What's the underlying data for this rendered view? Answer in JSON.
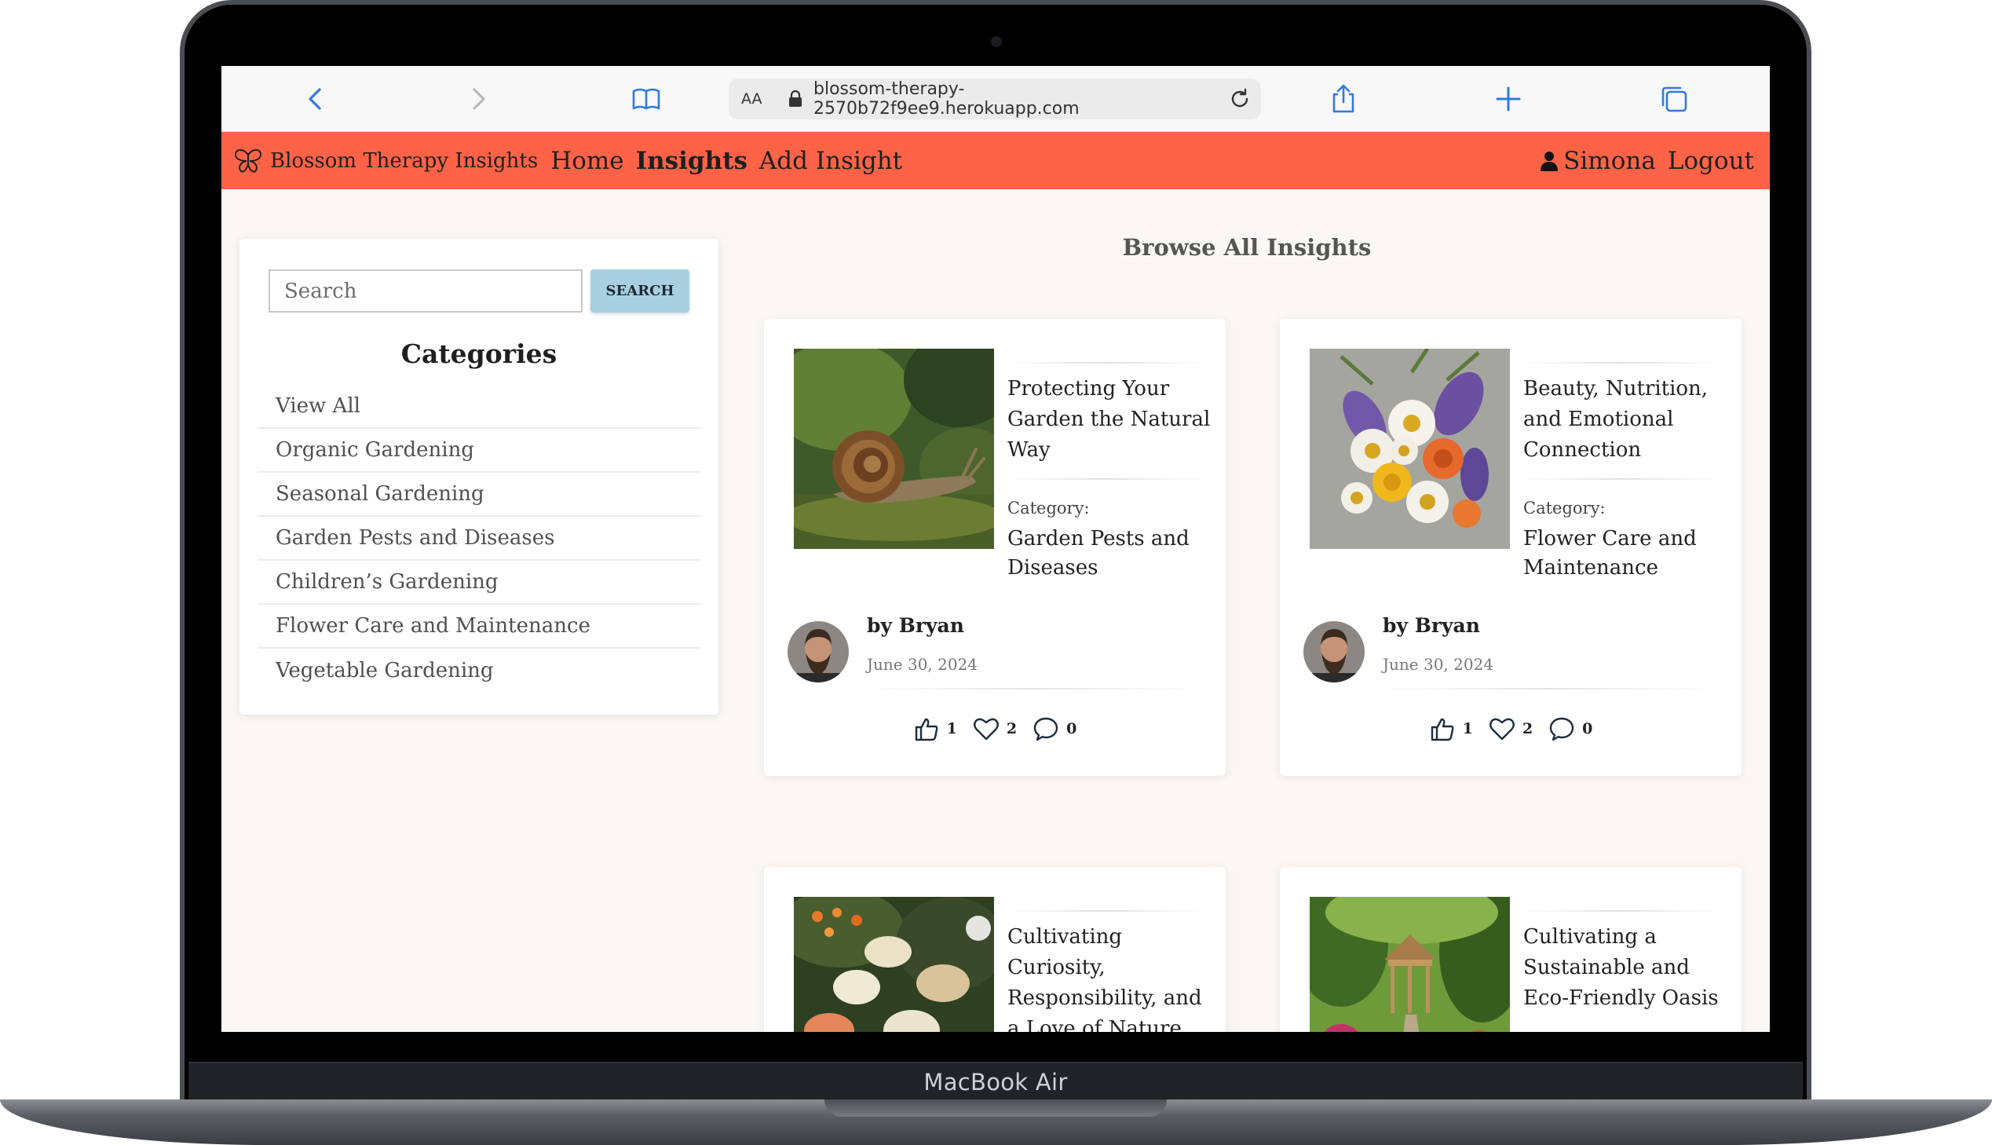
{
  "device": {
    "label": "MacBook Air"
  },
  "browser": {
    "text_size": "AA",
    "url": "blossom-therapy-2570b72f9ee9.herokuapp.com"
  },
  "nav": {
    "brand": "Blossom Therapy Insights",
    "links": [
      "Home",
      "Insights",
      "Add Insight"
    ],
    "user": "Simona",
    "logout": "Logout"
  },
  "sidebar": {
    "search_placeholder": "Search",
    "search_button": "SEARCH",
    "categories_title": "Categories",
    "categories": [
      "View All",
      "Organic Gardening",
      "Seasonal Gardening",
      "Garden Pests and Diseases",
      "Children’s Gardening",
      "Flower Care and Maintenance",
      "Vegetable Gardening"
    ]
  },
  "main": {
    "title": "Browse All Insights",
    "category_label": "Category:",
    "cards": [
      {
        "title": "Protecting Your Garden the Natural Way",
        "category": "Garden Pests and Diseases",
        "author": "by Bryan",
        "date": "June 30, 2024",
        "likes": "1",
        "hearts": "2",
        "comments": "0",
        "image": "snail-on-moss"
      },
      {
        "title": "Beauty, Nutrition, and Emotional Connection",
        "category": "Flower Care and Maintenance",
        "author": "by Bryan",
        "date": "June 30, 2024",
        "likes": "1",
        "hearts": "2",
        "comments": "0",
        "image": "flower-bouquet"
      },
      {
        "title": "Cultivating Curiosity, Responsibility, and a Love of Nature",
        "image": "garden-flowers"
      },
      {
        "title": "Cultivating a Sustainable and Eco-Friendly Oasis",
        "image": "garden-gazebo"
      }
    ]
  },
  "colors": {
    "nav_background": "#ff6347",
    "page_background": "#fbf7f4",
    "search_button": "#a9d0e1",
    "browser_accent": "#2f7ae5"
  }
}
